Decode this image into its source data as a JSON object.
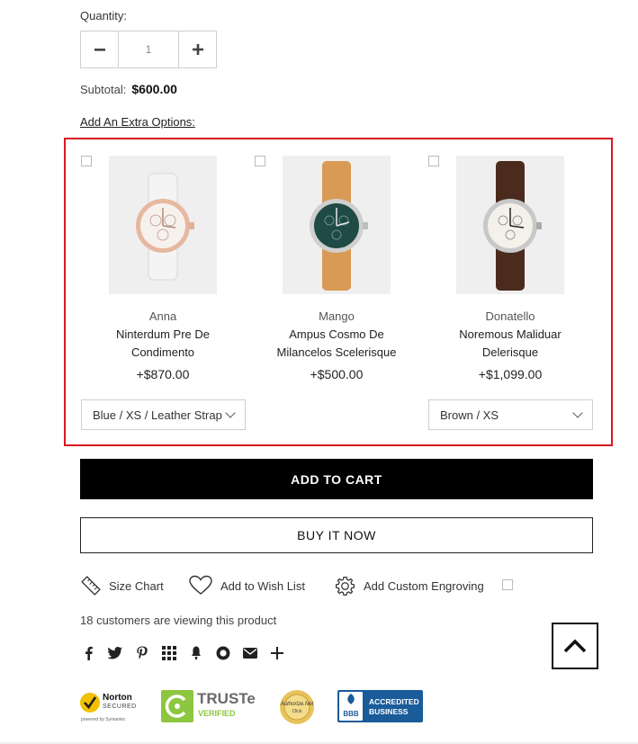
{
  "quantity": {
    "label": "Quantity:",
    "value": "1"
  },
  "subtotal": {
    "label": "Subtotal:",
    "value": "$600.00"
  },
  "extra_options_label": "Add An Extra Options:",
  "products": [
    {
      "brand": "Anna",
      "name_line1": "Ninterdum Pre De",
      "name_line2": "Condimento",
      "price": "+$870.00",
      "variant": "Blue / XS / Leather Strap"
    },
    {
      "brand": "Mango",
      "name_line1": "Ampus Cosmo De",
      "name_line2": "Milancelos Scelerisque",
      "price": "+$500.00"
    },
    {
      "brand": "Donatello",
      "name_line1": "Noremous Maliduar",
      "name_line2": "Delerisque",
      "price": "+$1,099.00",
      "variant": "Brown / XS"
    }
  ],
  "buttons": {
    "add_to_cart": "ADD TO CART",
    "buy_now": "BUY IT NOW"
  },
  "tools": {
    "size_chart": "Size Chart",
    "wishlist": "Add to Wish List",
    "engraving": "Add Custom Engroving"
  },
  "viewing_text": "18 customers are viewing this product",
  "social_icons": [
    "facebook-icon",
    "twitter-icon",
    "pinterest-icon",
    "grid-icon",
    "tumblr-icon",
    "reddit-icon",
    "email-icon",
    "plus-icon"
  ],
  "trust_badges": {
    "norton": {
      "title": "Norton",
      "line2": "SECURED",
      "line3": "powered by Symantec"
    },
    "truste": {
      "title": "TRUSTe",
      "line2": "VERIFIED"
    },
    "authorize": {
      "title": "Authorize.Net",
      "line2": "Click"
    },
    "bbb": {
      "title": "BBB",
      "line1": "ACCREDITED",
      "line2": "BUSINESS"
    }
  },
  "colors": {
    "accent_border": "#d71920",
    "button_dark": "#000000",
    "bbb_blue": "#1a5b9a",
    "truste_green": "#8dc63f"
  }
}
